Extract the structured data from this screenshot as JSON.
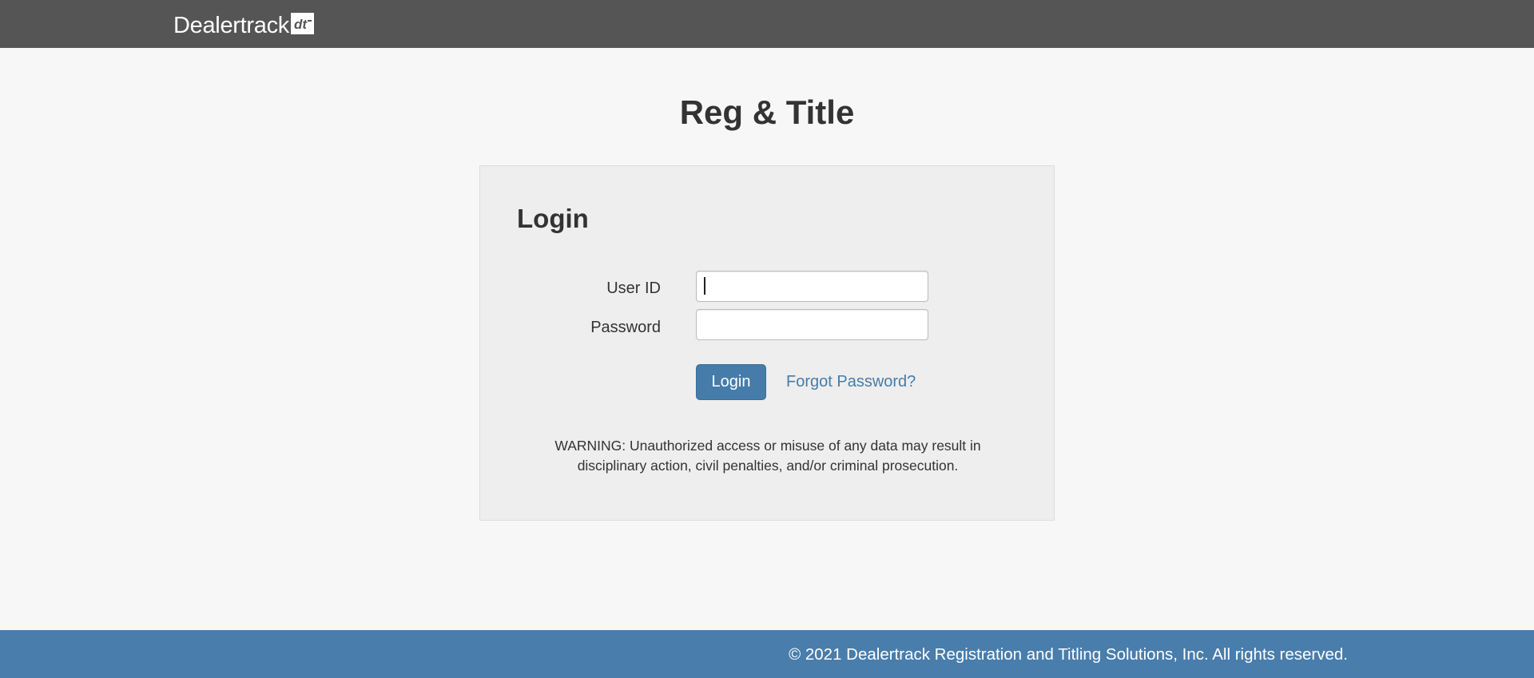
{
  "header": {
    "logo_text": "Dealertrack",
    "logo_mark": "dt"
  },
  "page": {
    "title": "Reg & Title"
  },
  "login": {
    "heading": "Login",
    "user_id_label": "User ID",
    "user_id_value": "",
    "password_label": "Password",
    "password_value": "",
    "login_button": "Login",
    "forgot_link": "Forgot Password?",
    "warning_line1": "WARNING: Unauthorized access or misuse of any data may result in",
    "warning_line2": "disciplinary action, civil penalties, and/or criminal prosecution."
  },
  "footer": {
    "copyright": "© 2021 Dealertrack Registration and Titling Solutions, Inc. All rights reserved."
  },
  "colors": {
    "topbar": "#555555",
    "background": "#f7f7f7",
    "panel": "#eeeeee",
    "accent": "#467ca9",
    "footer": "#487dac"
  }
}
